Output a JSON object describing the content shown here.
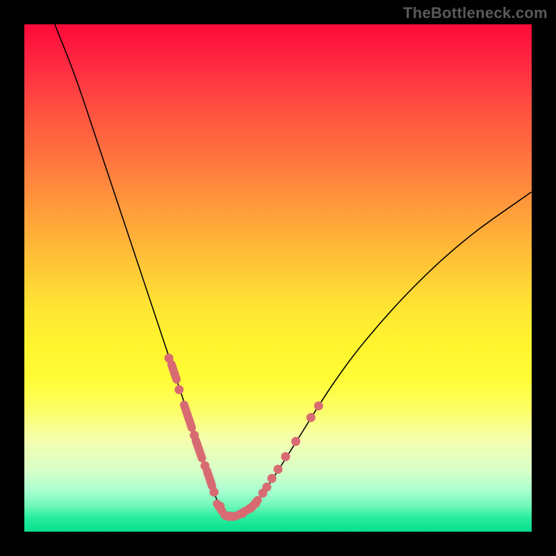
{
  "watermark": "TheBottleneck.com",
  "chart_data": {
    "type": "line",
    "title": "",
    "xlabel": "",
    "ylabel": "",
    "xlim": [
      0,
      100
    ],
    "ylim": [
      0,
      100
    ],
    "series": [
      {
        "name": "bottleneck-curve",
        "x": [
          6,
          10,
          14,
          18,
          22,
          26,
          30,
          32,
          34,
          36,
          37,
          38,
          39,
          40,
          42,
          44,
          46,
          50,
          55,
          60,
          65,
          70,
          75,
          80,
          85,
          90,
          95,
          100
        ],
        "y": [
          100,
          90,
          78,
          66,
          54,
          42,
          30,
          24,
          18,
          12,
          9,
          6,
          4,
          3,
          3,
          4,
          6,
          12,
          20,
          28,
          35,
          41,
          46.5,
          51.5,
          56,
          60,
          63.5,
          67
        ]
      }
    ],
    "markers": {
      "name": "series-points",
      "segments": [
        {
          "x0": 29.0,
          "y0": 33.0,
          "x1": 30.0,
          "y1": 30.0
        },
        {
          "x0": 31.5,
          "y0": 25.0,
          "x1": 33.0,
          "y1": 20.5
        },
        {
          "x0": 33.8,
          "y0": 18.0,
          "x1": 35.0,
          "y1": 14.5
        },
        {
          "x0": 36.0,
          "y0": 12.0,
          "x1": 37.0,
          "y1": 9.0
        },
        {
          "x0": 38.0,
          "y0": 5.5,
          "x1": 39.0,
          "y1": 4.0
        },
        {
          "x0": 39.5,
          "y0": 3.2,
          "x1": 41.5,
          "y1": 3.0
        },
        {
          "x0": 42.0,
          "y0": 3.2,
          "x1": 44.0,
          "y1": 4.3
        },
        {
          "x0": 45.0,
          "y0": 5.0,
          "x1": 46.0,
          "y1": 6.2
        }
      ],
      "dots": [
        {
          "x": 28.5,
          "y": 34.2
        },
        {
          "x": 30.5,
          "y": 28.0
        },
        {
          "x": 33.5,
          "y": 19.0
        },
        {
          "x": 35.6,
          "y": 13.0
        },
        {
          "x": 37.4,
          "y": 7.8
        },
        {
          "x": 38.6,
          "y": 5.0
        },
        {
          "x": 40.2,
          "y": 3.0
        },
        {
          "x": 41.0,
          "y": 3.0
        },
        {
          "x": 43.0,
          "y": 3.6
        },
        {
          "x": 44.5,
          "y": 4.6
        },
        {
          "x": 45.6,
          "y": 5.6
        },
        {
          "x": 47.0,
          "y": 7.6
        },
        {
          "x": 47.8,
          "y": 8.8
        },
        {
          "x": 48.8,
          "y": 10.5
        },
        {
          "x": 50.0,
          "y": 12.3
        },
        {
          "x": 51.5,
          "y": 14.8
        },
        {
          "x": 53.5,
          "y": 17.8
        },
        {
          "x": 56.5,
          "y": 22.5
        },
        {
          "x": 58.0,
          "y": 24.8
        }
      ]
    }
  }
}
